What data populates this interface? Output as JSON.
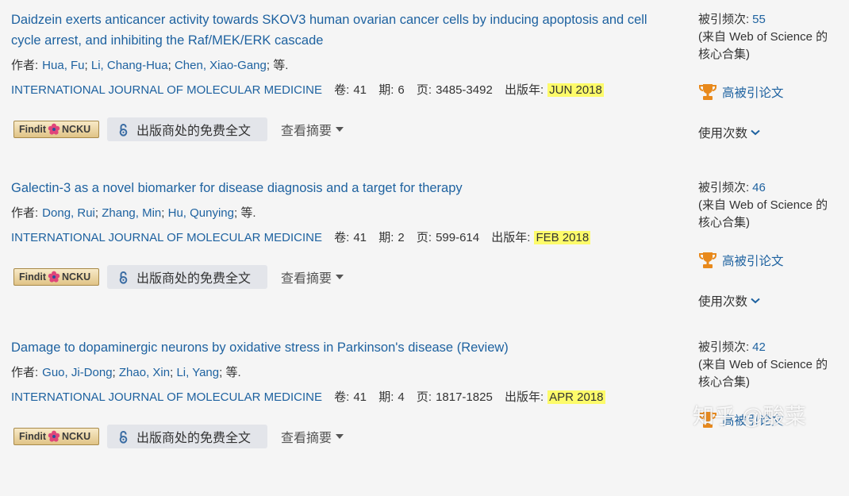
{
  "labels": {
    "authors": "作者:",
    "author_sep": "; ",
    "authors_more": "等.",
    "volume": "卷:",
    "issue": "期:",
    "pages": "页:",
    "pubyear": "出版年:",
    "findit_left": "Findit",
    "findit_right": "NCKU",
    "free_fulltext": "出版商处的免费全文",
    "view_abstract": "查看摘要",
    "times_cited": "被引频次:",
    "source_note": "(来自 Web of Science 的核心合集)",
    "highly_cited": "高被引论文",
    "usage": "使用次数"
  },
  "records": [
    {
      "title": "Daidzein exerts anticancer activity towards SKOV3 human ovarian cancer cells by inducing apoptosis and cell cycle arrest, and inhibiting the Raf/MEK/ERK cascade",
      "authors": [
        "Hua, Fu",
        "Li, Chang-Hua",
        "Chen, Xiao-Gang"
      ],
      "journal": "INTERNATIONAL JOURNAL OF MOLECULAR MEDICINE",
      "volume": "41",
      "issue": "6",
      "pages": "3485-3492",
      "pubyear": "JUN 2018",
      "times_cited": "55",
      "highly_cited": true,
      "usage_visible": true
    },
    {
      "title": "Galectin-3 as a novel biomarker for disease diagnosis and a target for therapy",
      "authors": [
        "Dong, Rui",
        "Zhang, Min",
        "Hu, Qunying"
      ],
      "journal": "INTERNATIONAL JOURNAL OF MOLECULAR MEDICINE",
      "volume": "41",
      "issue": "2",
      "pages": "599-614",
      "pubyear": "FEB 2018",
      "times_cited": "46",
      "highly_cited": true,
      "usage_visible": true
    },
    {
      "title": "Damage to dopaminergic neurons by oxidative stress in Parkinson's disease (Review)",
      "authors": [
        "Guo, Ji-Dong",
        "Zhao, Xin",
        "Li, Yang"
      ],
      "journal": "INTERNATIONAL JOURNAL OF MOLECULAR MEDICINE",
      "volume": "41",
      "issue": "4",
      "pages": "1817-1825",
      "pubyear": "APR 2018",
      "times_cited": "42",
      "highly_cited": true,
      "usage_visible": false
    }
  ],
  "icons": {
    "findit": "ncku-flower-icon",
    "free_fulltext": "open-access-icon",
    "view_abstract": "caret-down-icon",
    "highly_cited": "trophy-icon",
    "usage": "chevron-down-icon"
  },
  "watermark": "知乎 @酸菜",
  "colors": {
    "link": "#1e62a0",
    "text": "#333333",
    "muted": "#555555",
    "highlight": "#fdfb6a",
    "trophy": "#e8891c",
    "oa": "#3a6ca3",
    "bg": "#f5f5f5",
    "btn-bg": "#e3e5ea"
  }
}
